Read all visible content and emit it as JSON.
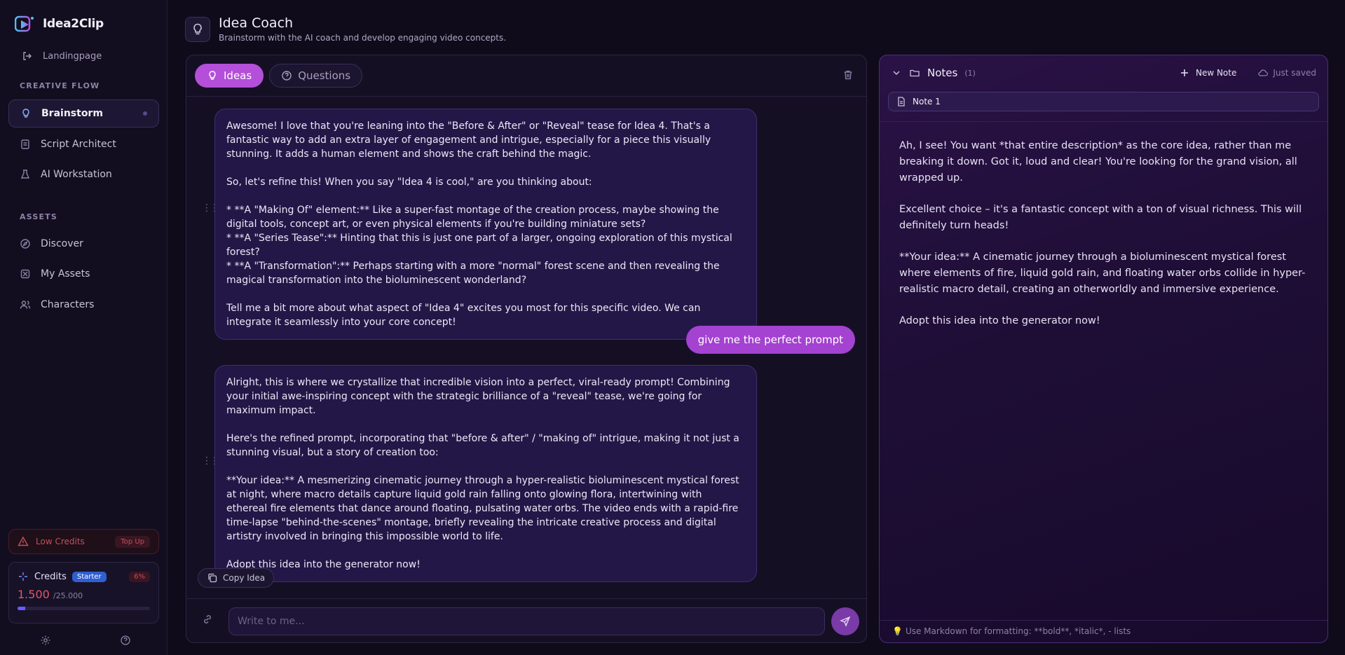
{
  "app": {
    "name": "Idea2Clip"
  },
  "sidebar": {
    "landing_label": "Landingpage",
    "creative_flow_label": "CREATIVE FLOW",
    "assets_label": "ASSETS",
    "items": [
      {
        "label": "Brainstorm",
        "icon": "bulb-icon",
        "active": true
      },
      {
        "label": "Script Architect",
        "icon": "script-icon"
      },
      {
        "label": "AI Workstation",
        "icon": "flask-icon"
      },
      {
        "label": "Discover",
        "icon": "compass-icon"
      },
      {
        "label": "My Assets",
        "icon": "assets-icon"
      },
      {
        "label": "Characters",
        "icon": "users-icon"
      }
    ],
    "low_credits": {
      "label": "Low Credits",
      "action": "Top Up"
    },
    "credits": {
      "label": "Credits",
      "plan": "Starter",
      "percent_label": "6%",
      "amount": "1.500",
      "total": "/25.000",
      "progress_fraction": 0.06
    }
  },
  "header": {
    "title": "Idea Coach",
    "subtitle": "Brainstorm with the AI coach and develop engaging video concepts."
  },
  "chat": {
    "tabs": [
      {
        "label": "Ideas",
        "active": true
      },
      {
        "label": "Questions",
        "active": false
      }
    ],
    "messages": [
      {
        "role": "assistant",
        "paragraphs": [
          "Awesome! I love that you're leaning into the \"Before & After\" or \"Reveal\" tease for Idea 4. That's a fantastic way to add an extra layer of engagement and intrigue, especially for a piece this visually stunning. It adds a human element and shows the craft behind the magic.",
          "So, let's refine this! When you say \"Idea 4 is cool,\" are you thinking about:",
          "*  **A \"Making Of\" element:** Like a super-fast montage of the creation process, maybe showing the digital tools, concept art, or even physical elements if you're building miniature sets?\n*  **A \"Series Tease\":** Hinting that this is just one part of a larger, ongoing exploration of this mystical forest?\n*  **A \"Transformation\":** Perhaps starting with a more \"normal\" forest scene and then revealing the magical transformation into the bioluminescent wonderland?",
          "Tell me a bit more about what aspect of \"Idea 4\" excites you most for this specific video. We can integrate it seamlessly into your core concept!"
        ]
      },
      {
        "role": "user",
        "text": "give me the perfect prompt"
      },
      {
        "role": "assistant",
        "paragraphs": [
          "Alright, this is where we crystallize that incredible vision into a perfect, viral-ready prompt! Combining your initial awe-inspiring concept with the strategic brilliance of a \"reveal\" tease, we're going for maximum impact.",
          "Here's the refined prompt, incorporating that \"before & after\" / \"making of\" intrigue, making it not just a stunning visual, but a story of creation too:",
          "**Your idea:** A mesmerizing cinematic journey through a hyper-realistic bioluminescent mystical forest at night, where macro details capture liquid gold rain falling onto glowing flora, intertwining with ethereal fire elements that dance around floating, pulsating water orbs. The video ends with a rapid-fire time-lapse \"behind-the-scenes\" montage, briefly revealing the intricate creative process and digital artistry involved in bringing this impossible world to life.",
          "Adopt this idea into the generator now!"
        ]
      }
    ],
    "copy_label": "Copy Idea",
    "input_placeholder": "Write to me..."
  },
  "notes": {
    "title": "Notes",
    "count": "(1)",
    "new_note_label": "New Note",
    "saved_label": "Just saved",
    "tab_label": "Note 1",
    "body": [
      "Ah, I see! You want *that entire description* as the core idea, rather than me breaking it down. Got it, loud and clear! You're looking for the grand vision, all wrapped up.",
      "Excellent choice – it's a fantastic concept with a ton of visual richness. This will definitely turn heads!",
      "**Your idea:** A cinematic journey through a bioluminescent mystical forest where elements of fire, liquid gold rain, and floating water orbs collide in hyper-realistic macro detail, creating an otherworldly and immersive experience.",
      "Adopt this idea into the generator now!"
    ],
    "footer_hint": "Use Markdown for formatting: **bold**, *italic*, - lists"
  },
  "colors": {
    "accent": "#b44fd9",
    "bubble": "#231747",
    "danger": "#c2505e",
    "plan_badge": "#2f5fd0"
  }
}
